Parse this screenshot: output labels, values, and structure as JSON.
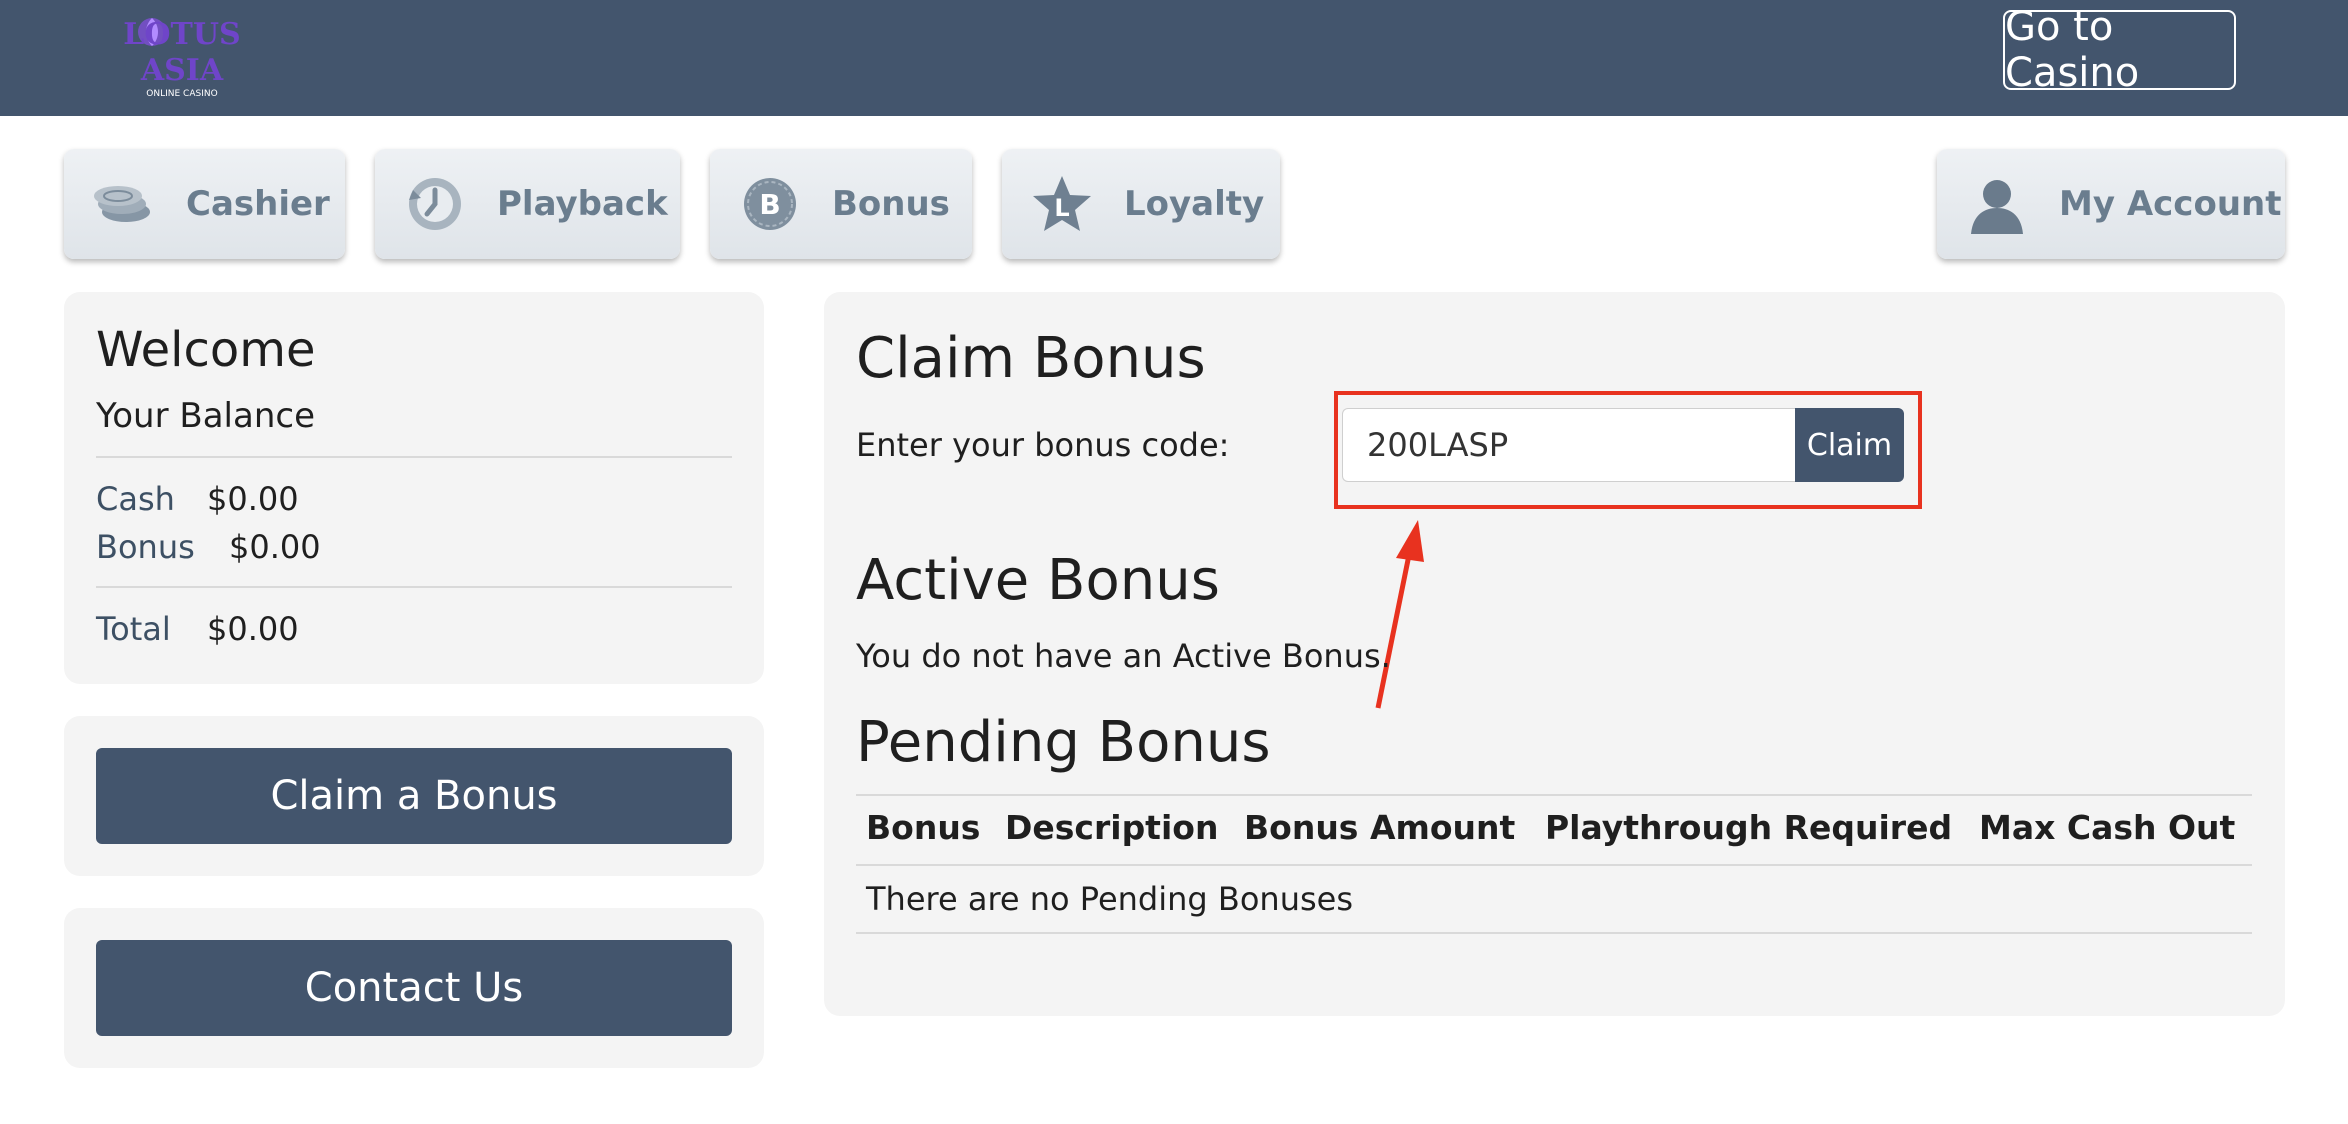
{
  "header": {
    "logo_line1": "LOTUS",
    "logo_line2": "ASIA",
    "logo_tagline": "ONLINE CASINO",
    "go_to_casino": "Go to Casino"
  },
  "nav": {
    "cashier": "Cashier",
    "playback": "Playback",
    "bonus": "Bonus",
    "loyalty": "Loyalty",
    "my_account": "My Account"
  },
  "welcome_panel": {
    "title": "Welcome",
    "subtitle": "Your Balance",
    "cash_label": "Cash",
    "cash_value": "$0.00",
    "bonus_label": "Bonus",
    "bonus_value": "$0.00",
    "total_label": "Total",
    "total_value": "$0.00"
  },
  "sidebar_buttons": {
    "claim_bonus": "Claim a Bonus",
    "contact_us": "Contact Us"
  },
  "claim_bonus": {
    "title": "Claim Bonus",
    "prompt": "Enter your bonus code:",
    "code_value": "200LASP",
    "claim_button": "Claim"
  },
  "active_bonus": {
    "title": "Active Bonus",
    "message": "You do not have an Active Bonus."
  },
  "pending_bonus": {
    "title": "Pending Bonus",
    "columns": [
      "Bonus",
      "Description",
      "Bonus Amount",
      "Playthrough Required",
      "Max Cash Out"
    ],
    "empty_message": "There are no Pending Bonuses"
  },
  "colors": {
    "header_bg": "#43556d",
    "button_bg": "#43556d",
    "highlight": "#e8321f",
    "panel_bg": "#f4f4f4"
  }
}
